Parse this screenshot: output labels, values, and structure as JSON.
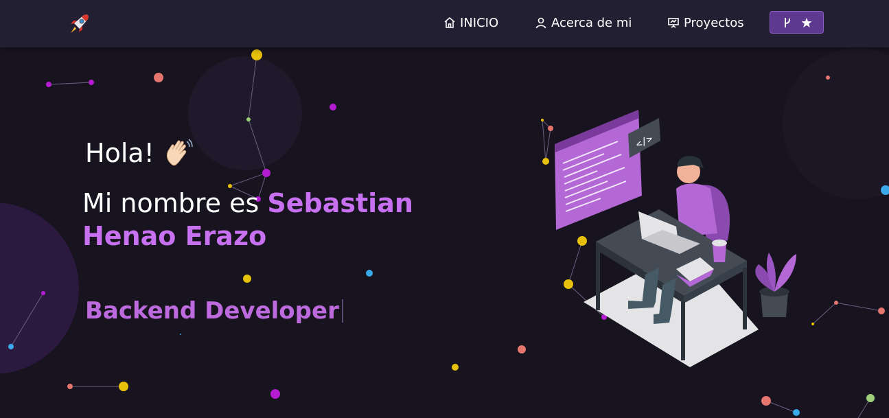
{
  "navbar": {
    "logo_icon": "rocket-icon",
    "items": [
      {
        "label": "INICIO",
        "icon": "home-icon"
      },
      {
        "label": "Acerca de mi",
        "icon": "user-icon"
      },
      {
        "label": "Proyectos",
        "icon": "presentation-icon"
      }
    ],
    "github_button": {
      "icons": [
        "git-fork-icon",
        "star-icon"
      ]
    }
  },
  "hero": {
    "greeting": "Hola!",
    "greeting_emoji": "waving-hand-icon",
    "name_prefix": "Mi nombre es ",
    "name": "Sebastian Henao Erazo",
    "role": "Backend Developer"
  },
  "colors": {
    "background": "#17141f",
    "navbar": "#221f33",
    "accent": "#c770f0",
    "button": "#5d3a8f"
  }
}
